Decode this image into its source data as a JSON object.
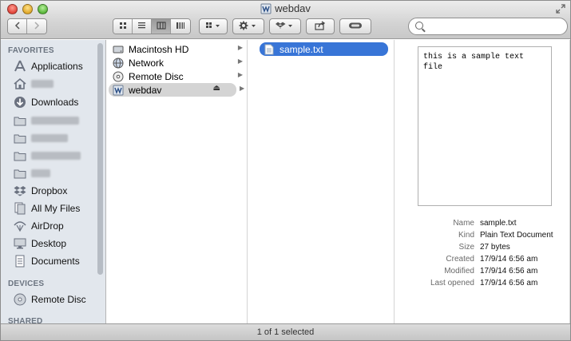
{
  "window": {
    "title": "webdav"
  },
  "toolbar": {
    "back_icon": "chevron-left-icon",
    "forward_icon": "chevron-right-icon",
    "view_icons": [
      "icon-view-icon",
      "list-view-icon",
      "column-view-icon",
      "coverflow-view-icon"
    ],
    "active_view": 2,
    "arrange_icon": "arrange-icon",
    "action_icon": "gear-icon",
    "dropbox_icon": "dropbox-icon",
    "share_icon": "share-icon",
    "tags_icon": "tag-icon",
    "search_placeholder": ""
  },
  "sidebar": {
    "favorites_header": "FAVORITES",
    "favorites": [
      {
        "label": "Applications",
        "icon": "applications-icon"
      },
      {
        "label": "",
        "icon": "home-icon",
        "redacted": true
      },
      {
        "label": "Downloads",
        "icon": "downloads-icon"
      },
      {
        "label": "",
        "icon": "folder-icon",
        "redacted": true
      },
      {
        "label": "",
        "icon": "folder-icon",
        "redacted": true
      },
      {
        "label": "",
        "icon": "folder-icon",
        "redacted": true
      },
      {
        "label": "",
        "icon": "folder-icon",
        "redacted": true
      },
      {
        "label": "Dropbox",
        "icon": "dropbox-icon"
      },
      {
        "label": "All My Files",
        "icon": "all-files-icon"
      },
      {
        "label": "AirDrop",
        "icon": "airdrop-icon"
      },
      {
        "label": "Desktop",
        "icon": "desktop-icon"
      },
      {
        "label": "Documents",
        "icon": "documents-icon"
      }
    ],
    "devices_header": "DEVICES",
    "devices": [
      {
        "label": "Remote Disc",
        "icon": "disc-icon"
      }
    ],
    "shared_header": "SHARED"
  },
  "column1": {
    "items": [
      {
        "label": "Macintosh HD",
        "icon": "hard-drive-icon"
      },
      {
        "label": "Network",
        "icon": "network-icon"
      },
      {
        "label": "Remote Disc",
        "icon": "disc-icon"
      },
      {
        "label": "webdav",
        "icon": "server-drive-icon",
        "selected": true
      }
    ]
  },
  "column2": {
    "items": [
      {
        "label": "sample.txt",
        "icon": "text-file-icon",
        "selected": true
      }
    ]
  },
  "preview": {
    "text": "this is a sample text file"
  },
  "info": {
    "rows": [
      {
        "key": "Name",
        "value": "sample.txt"
      },
      {
        "key": "Kind",
        "value": "Plain Text Document"
      },
      {
        "key": "Size",
        "value": "27 bytes"
      },
      {
        "key": "Created",
        "value": "17/9/14 6:56 am"
      },
      {
        "key": "Modified",
        "value": "17/9/14 6:56 am"
      },
      {
        "key": "Last opened",
        "value": "17/9/14 6:56 am"
      }
    ]
  },
  "status": {
    "text": "1 of 1 selected"
  },
  "colors": {
    "selection": "#3875d7",
    "sidebar_bg": "#e2e7ed"
  }
}
